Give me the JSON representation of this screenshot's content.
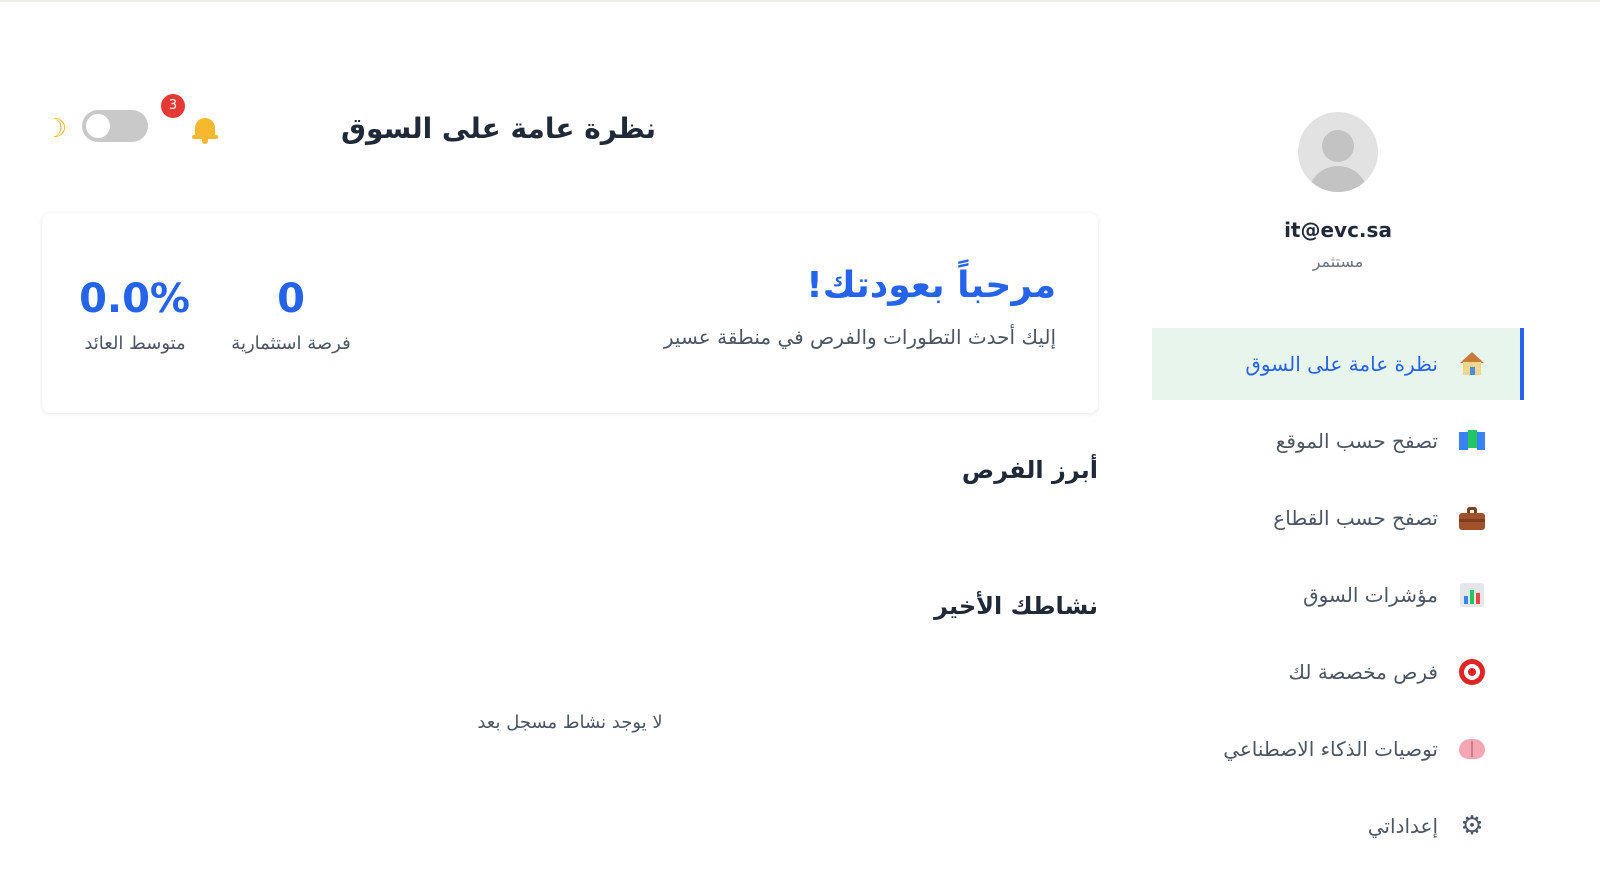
{
  "sidebar": {
    "user": {
      "email": "it@evc.sa",
      "role": "مستثمر"
    },
    "items": [
      {
        "label": "نظرة عامة على السوق",
        "icon": "house-icon",
        "active": true
      },
      {
        "label": "تصفح حسب الموقع",
        "icon": "map-icon",
        "active": false
      },
      {
        "label": "تصفح حسب القطاع",
        "icon": "briefcase-icon",
        "active": false
      },
      {
        "label": "مؤشرات السوق",
        "icon": "bar-chart-icon",
        "active": false
      },
      {
        "label": "فرص مخصصة لك",
        "icon": "target-icon",
        "active": false
      },
      {
        "label": "توصيات الذكاء الاصطناعي",
        "icon": "brain-icon",
        "active": false
      },
      {
        "label": "إعداداتي",
        "icon": "gear-icon",
        "active": false
      }
    ]
  },
  "header": {
    "title": "نظرة عامة على السوق",
    "notifications_count": "3",
    "dark_mode": false
  },
  "welcome": {
    "title": "مرحباً بعودتك!",
    "subtitle": "إليك أحدث التطورات والفرص في منطقة عسير",
    "stats": [
      {
        "value": "0",
        "label": "فرصة استثمارية"
      },
      {
        "value": "0.0%",
        "label": "متوسط العائد"
      }
    ]
  },
  "sections": {
    "featured_title": "أبرز الفرص",
    "activity_title": "نشاطك الأخير",
    "activity_empty": "لا يوجد نشاط مسجل بعد"
  },
  "colors": {
    "accent": "#2563eb",
    "active_bg": "#e8f5ec",
    "badge": "#e53935",
    "bell": "#f5b82e"
  }
}
